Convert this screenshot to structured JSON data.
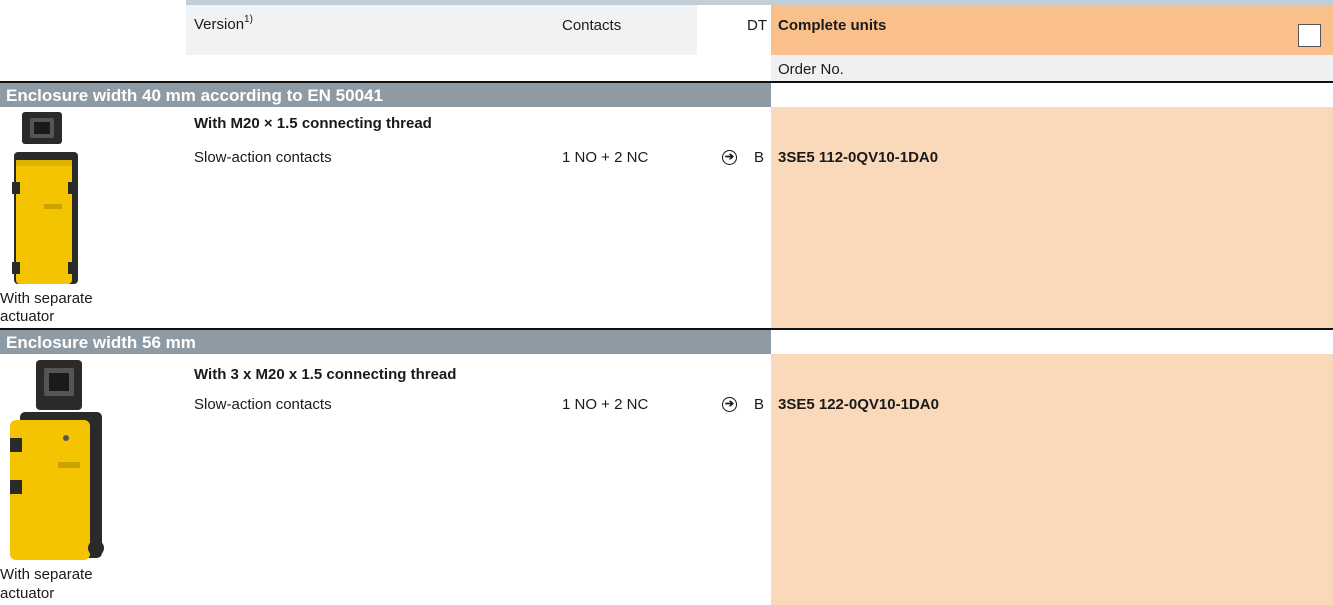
{
  "header": {
    "version_label": "Version",
    "version_footnote": "1)",
    "contacts_label": "Contacts",
    "dt_label": "DT",
    "complete_units_label": "Complete units",
    "order_no_label": "Order No."
  },
  "sections": [
    {
      "title": "Enclosure width 40 mm according to EN 50041",
      "subheading": "With M20 × 1.5 connecting thread",
      "version": "Slow-action contacts",
      "contacts": "1 NO + 2 NC",
      "dt_symbol": "➔",
      "dt": "B",
      "order_no": "3SE5 112-0QV10-1DA0",
      "image_caption_line1": "With separate",
      "image_caption_line2": "actuator"
    },
    {
      "title": "Enclosure width 56 mm",
      "subheading": "With 3 x M20 x 1.5 connecting thread",
      "version": "Slow-action contacts",
      "contacts": "1 NO + 2 NC",
      "dt_symbol": "➔",
      "dt": "B",
      "order_no": "3SE5 122-0QV10-1DA0",
      "image_caption_line1": "With separate",
      "image_caption_line2": "actuator"
    }
  ],
  "colors": {
    "header_orange": "#f9c08b",
    "peach": "#fad9ba",
    "band_gray": "#8e9ba5",
    "device_yellow": "#f5c400",
    "device_black": "#2a2a2a"
  }
}
